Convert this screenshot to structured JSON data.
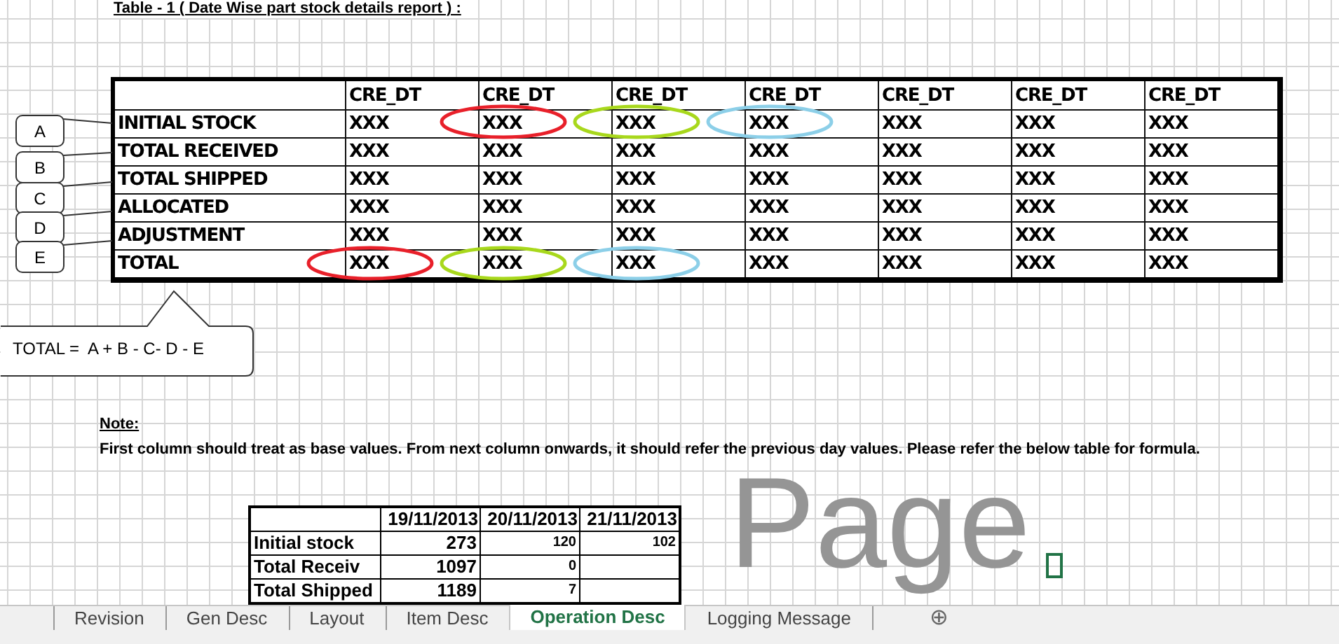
{
  "title": "Table - 1 ( Date Wise part stock details report ) :",
  "report_table": {
    "columns": [
      "CRE_DT",
      "CRE_DT",
      "CRE_DT",
      "CRE_DT",
      "CRE_DT",
      "CRE_DT",
      "CRE_DT"
    ],
    "rows": [
      {
        "label": "INITIAL STOCK",
        "cells": [
          "XXX",
          {
            "text": "XXX",
            "color": "#e8202a"
          },
          {
            "text": "XXX",
            "color": "#a8d81c"
          },
          {
            "text": "XXX",
            "color": "#8ccfe8"
          },
          "XXX",
          "XXX",
          "XXX"
        ]
      },
      {
        "label": "TOTAL RECEIVED",
        "cells": [
          "XXX",
          "XXX",
          "XXX",
          "XXX",
          "XXX",
          "XXX",
          "XXX"
        ]
      },
      {
        "label": "TOTAL SHIPPED",
        "cells": [
          "XXX",
          "XXX",
          "XXX",
          "XXX",
          "XXX",
          "XXX",
          "XXX"
        ]
      },
      {
        "label": "ALLOCATED",
        "cells": [
          "XXX",
          "XXX",
          "XXX",
          "XXX",
          "XXX",
          "XXX",
          "XXX"
        ]
      },
      {
        "label": "ADJUSTMENT",
        "cells": [
          "XXX",
          "XXX",
          "XXX",
          "XXX",
          "XXX",
          "XXX",
          "XXX"
        ]
      },
      {
        "label": "TOTAL",
        "cells": [
          {
            "text": "XXX",
            "color": "#e8202a"
          },
          {
            "text": "XXX",
            "color": "#a8d81c"
          },
          {
            "text": "XXX",
            "color": "#8ccfe8"
          },
          "XXX",
          "XXX",
          "XXX",
          "XXX"
        ]
      }
    ]
  },
  "callouts": [
    "A",
    "B",
    "C",
    "D",
    "E"
  ],
  "formula": "TOTAL =  A + B - C- D - E",
  "note": {
    "heading": "Note:",
    "text": "First column should treat as base values. From next column onwards, it should refer the previous day values. Please refer the below table for formula."
  },
  "sample_table": {
    "columns": [
      "19/11/2013",
      "20/11/2013",
      "21/11/2013"
    ],
    "rows": [
      {
        "label": "Initial stock",
        "cells": [
          "273",
          "120",
          "102"
        ]
      },
      {
        "label": "Total Receiv",
        "cells": [
          "1097",
          "0"
        ]
      },
      {
        "label": "Total Shipped",
        "cells": [
          "1189",
          "7"
        ]
      }
    ]
  },
  "watermark": "Page",
  "sheet_tabs": [
    {
      "label": "Revision",
      "selected": false
    },
    {
      "label": "Gen Desc",
      "selected": false
    },
    {
      "label": "Layout",
      "selected": false
    },
    {
      "label": "Item Desc",
      "selected": false
    },
    {
      "label": "Operation Desc",
      "selected": true
    },
    {
      "label": "Logging Message",
      "selected": false
    }
  ],
  "add_sheet": "⊕"
}
